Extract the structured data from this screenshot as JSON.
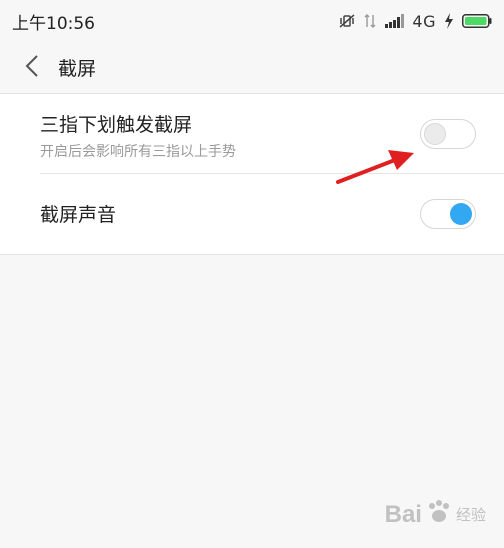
{
  "status_bar": {
    "time": "上午10:56",
    "network": "4G",
    "icons": [
      "vibrate-icon",
      "data-arrows-icon",
      "signal-icon",
      "charging-bolt-icon",
      "battery-icon"
    ],
    "battery_color": "#4cd964"
  },
  "header": {
    "title": "截屏",
    "back_icon": "chevron-left-icon"
  },
  "settings": [
    {
      "title": "三指下划触发截屏",
      "subtitle": "开启后会影响所有三指以上手势",
      "enabled": false
    },
    {
      "title": "截屏声音",
      "enabled": true
    }
  ],
  "colors": {
    "toggle_on": "#32a7f2",
    "annotation_arrow": "#e02020"
  },
  "watermark": {
    "brand": "Bai",
    "suffix": "经验"
  }
}
